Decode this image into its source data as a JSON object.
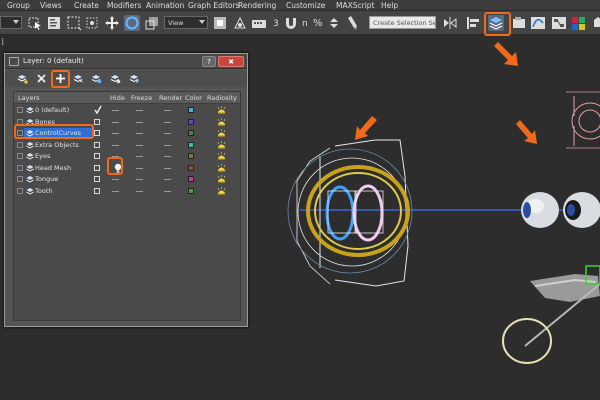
{
  "menubar": {
    "items": [
      "Group",
      "Views",
      "Create",
      "Modifiers",
      "Animation",
      "Graph Editors",
      "Rendering",
      "Customize",
      "MAXScript",
      "Help"
    ]
  },
  "toolbar": {
    "selection_filter_value": "",
    "ref_coord_value": "View",
    "named_selection_placeholder": "Create Selection Se",
    "percent_snap_label": "%",
    "snap_label": "3",
    "angle_snap_label": "n"
  },
  "viewport": {
    "corner_label": "]"
  },
  "layer_dialog": {
    "title": "Layer: 0 (default)",
    "help_label": "?",
    "close_label": "✖",
    "columns": [
      "Layers",
      "Hide",
      "Freeze",
      "Render",
      "Color",
      "Radiosity"
    ],
    "layers": [
      {
        "name": "0 (default)",
        "current": true,
        "hidden": false,
        "color": "#3fb3d8",
        "selected": false
      },
      {
        "name": "Bones",
        "current": false,
        "hidden": false,
        "color": "#6a45c8",
        "selected": false
      },
      {
        "name": "ControlCurves",
        "current": false,
        "hidden": false,
        "color": "#3a8a3a",
        "selected": true
      },
      {
        "name": "Extra Objects",
        "current": false,
        "hidden": false,
        "color": "#38c0b8",
        "selected": false
      },
      {
        "name": "Eyes",
        "current": false,
        "hidden": false,
        "color": "#7a7a2a",
        "selected": false
      },
      {
        "name": "Head Mesh",
        "current": false,
        "hidden": true,
        "color": "#8a5a2a",
        "selected": false
      },
      {
        "name": "Tongue",
        "current": false,
        "hidden": false,
        "color": "#c63a9a",
        "selected": false
      },
      {
        "name": "Tooth",
        "current": false,
        "hidden": false,
        "color": "#3aa83a",
        "selected": false
      }
    ]
  },
  "colors": {
    "highlight": "#f06a1a",
    "selection": "#2f6fd6"
  }
}
